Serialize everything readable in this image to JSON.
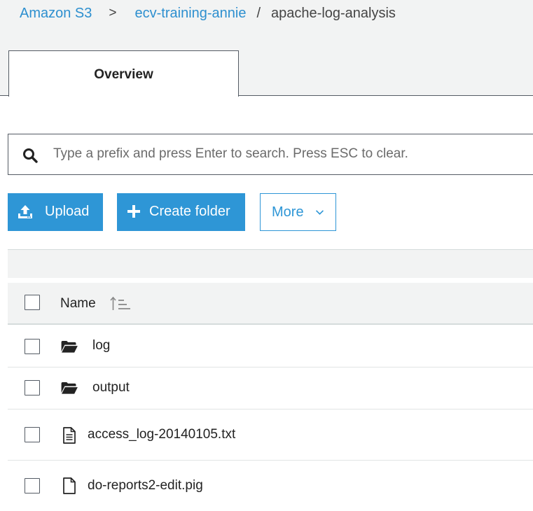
{
  "breadcrumb": {
    "root": "Amazon S3",
    "sep1": ">",
    "bucket": "ecv-training-annie",
    "sep2": "/",
    "folder": "apache-log-analysis"
  },
  "tabs": [
    {
      "label": "Overview",
      "active": true
    }
  ],
  "search": {
    "placeholder": "Type a prefix and press Enter to search. Press ESC to clear.",
    "value": ""
  },
  "toolbar": {
    "upload_label": "Upload",
    "create_folder_label": "Create folder",
    "more_label": "More"
  },
  "table": {
    "header_name": "Name",
    "rows": [
      {
        "name": "log",
        "type": "folder",
        "icon": "folder-icon"
      },
      {
        "name": "output",
        "type": "folder",
        "icon": "folder-icon"
      },
      {
        "name": "access_log-20140105.txt",
        "type": "file",
        "icon": "text-file-icon"
      },
      {
        "name": "do-reports2-edit.pig",
        "type": "file",
        "icon": "file-icon"
      }
    ]
  },
  "colors": {
    "accent": "#2e96d6",
    "link": "#2d8fcf",
    "border": "#545b64",
    "panel": "#f2f3f3"
  }
}
